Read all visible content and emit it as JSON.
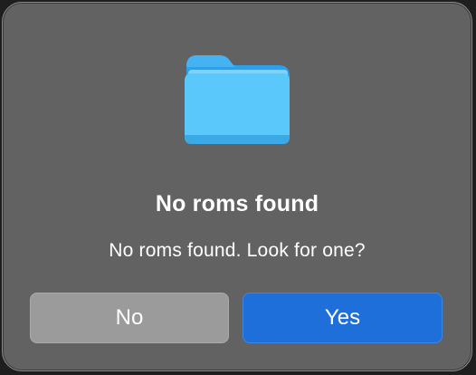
{
  "dialog": {
    "icon": "folder-icon",
    "title": "No roms found",
    "message": "No roms found. Look for one?",
    "buttons": {
      "no_label": "No",
      "yes_label": "Yes"
    }
  },
  "colors": {
    "dialog_background": "#626262",
    "folder_blue": "#5ac8fa",
    "primary_button": "#1e6fd9",
    "secondary_button": "#9b9b9b",
    "text": "#ffffff"
  }
}
